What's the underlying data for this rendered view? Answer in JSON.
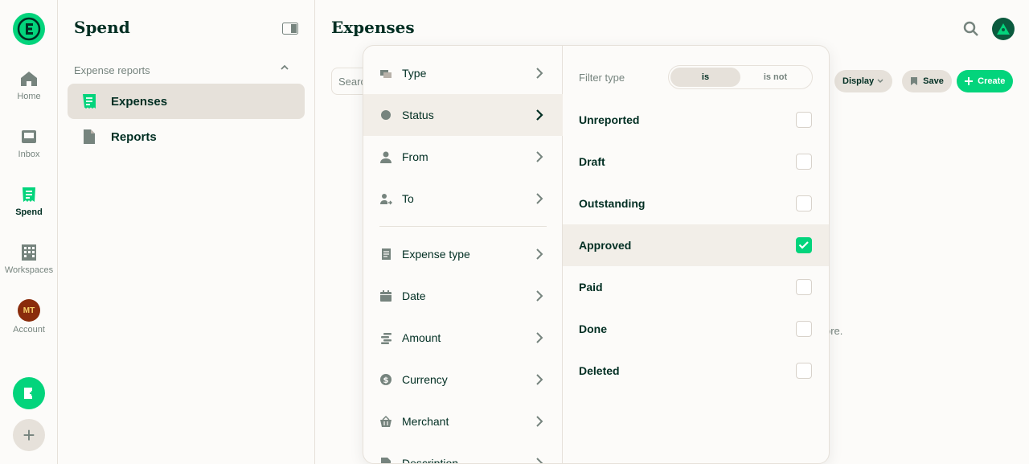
{
  "rail": {
    "items": [
      {
        "label": "Home",
        "icon": "home-icon"
      },
      {
        "label": "Inbox",
        "icon": "inbox-icon"
      },
      {
        "label": "Spend",
        "icon": "receipt-icon"
      },
      {
        "label": "Workspaces",
        "icon": "building-icon"
      },
      {
        "label": "Account",
        "icon": "avatar"
      }
    ],
    "account_initials": "MT"
  },
  "lhn": {
    "title": "Spend",
    "section": "Expense reports",
    "items": [
      {
        "label": "Expenses"
      },
      {
        "label": "Reports"
      }
    ]
  },
  "main": {
    "title": "Expenses",
    "search_placeholder": "Search",
    "display_label": "Display",
    "save_label": "Save",
    "create_label": "Create",
    "background_text": "ore."
  },
  "filter": {
    "fields": [
      {
        "label": "Type",
        "icon": "type-icon"
      },
      {
        "label": "Status",
        "icon": "status-icon"
      },
      {
        "label": "From",
        "icon": "person-icon"
      },
      {
        "label": "To",
        "icon": "person-arrow-icon"
      },
      {
        "label": "Expense type",
        "icon": "receipt-icon"
      },
      {
        "label": "Date",
        "icon": "calendar-icon"
      },
      {
        "label": "Amount",
        "icon": "coins-icon"
      },
      {
        "label": "Currency",
        "icon": "dollar-icon"
      },
      {
        "label": "Merchant",
        "icon": "basket-icon"
      },
      {
        "label": "Description",
        "icon": "document-icon"
      }
    ],
    "filter_type_label": "Filter type",
    "is_label": "is",
    "is_not_label": "is not",
    "statuses": [
      {
        "label": "Unreported",
        "checked": false
      },
      {
        "label": "Draft",
        "checked": false
      },
      {
        "label": "Outstanding",
        "checked": false
      },
      {
        "label": "Approved",
        "checked": true
      },
      {
        "label": "Paid",
        "checked": false
      },
      {
        "label": "Done",
        "checked": false
      },
      {
        "label": "Deleted",
        "checked": false
      }
    ]
  },
  "colors": {
    "accent": "#03d47c",
    "text": "#002e22",
    "muted": "#76847e",
    "border": "#e6e1da"
  }
}
